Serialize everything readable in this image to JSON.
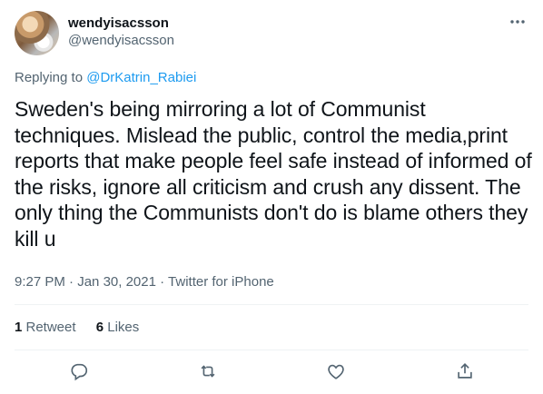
{
  "author": {
    "display_name": "wendyisacsson",
    "handle": "@wendyisacsson"
  },
  "reply": {
    "prefix": "Replying to ",
    "to": "@DrKatrin_Rabiei"
  },
  "tweet": {
    "text": "Sweden's being mirroring a lot of Communist techniques. Mislead the public, control the media,print reports that make people feel safe instead of informed of the risks, ignore all criticism and crush any dissent. The only thing the Communists don't do is blame others they kill u"
  },
  "meta": {
    "time": "9:27 PM",
    "separator1": " · ",
    "date": "Jan 30, 2021",
    "separator2": " · ",
    "source": "Twitter for iPhone"
  },
  "stats": {
    "retweets_count": "1",
    "retweets_label": " Retweet",
    "likes_count": "6",
    "likes_label": " Likes"
  },
  "icons": {
    "more": "more-icon",
    "reply": "reply-icon",
    "retweet": "retweet-icon",
    "like": "heart-icon",
    "share": "share-icon"
  },
  "colors": {
    "link": "#1d9bf0",
    "secondary_text": "#536471",
    "primary_text": "#0f1419",
    "divider": "#eff3f4"
  }
}
